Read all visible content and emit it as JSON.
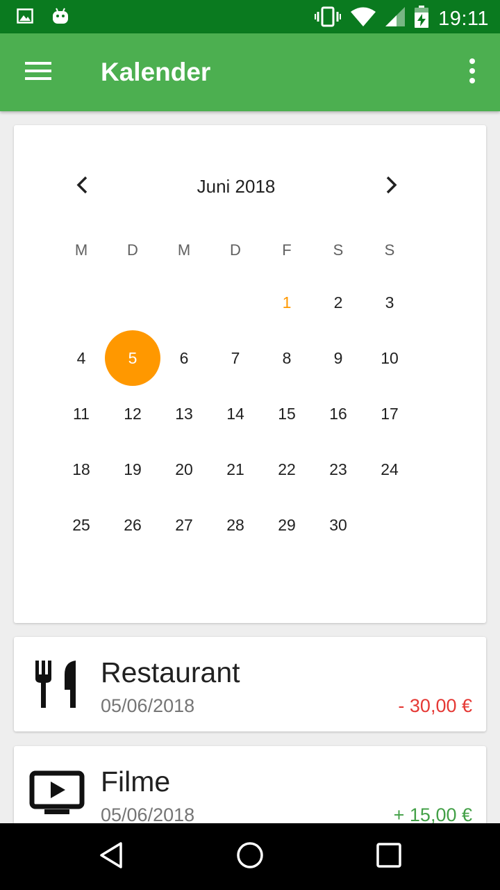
{
  "status_bar": {
    "time": "19:11",
    "icons": [
      "image-icon",
      "android-icon",
      "vibrate-icon",
      "wifi-icon",
      "signal-icon",
      "battery-charging-icon"
    ]
  },
  "app_bar": {
    "title": "Kalender",
    "icons": [
      "menu-icon",
      "more-vert-icon"
    ]
  },
  "calendar": {
    "month_label": "Juni 2018",
    "weekdays": [
      "M",
      "D",
      "M",
      "D",
      "F",
      "S",
      "S"
    ],
    "leading_empty_days": 4,
    "days": [
      "1",
      "2",
      "3",
      "4",
      "5",
      "6",
      "7",
      "8",
      "9",
      "10",
      "11",
      "12",
      "13",
      "14",
      "15",
      "16",
      "17",
      "18",
      "19",
      "20",
      "21",
      "22",
      "23",
      "24",
      "25",
      "26",
      "27",
      "28",
      "29",
      "30"
    ],
    "highlighted_day": "1",
    "selected_day": "5",
    "accent_color": "#ff9800"
  },
  "transactions": [
    {
      "title": "Restaurant",
      "date": "05/06/2018",
      "amount": "- 30,00 €",
      "amount_color": "#e53935",
      "icon": "restaurant-icon"
    },
    {
      "title": "Filme",
      "date": "05/06/2018",
      "amount": "+ 15,00 €",
      "amount_color": "#43a047",
      "icon": "tv-play-icon"
    }
  ],
  "nav_bar": {
    "icons": [
      "back-icon",
      "home-icon",
      "recents-icon"
    ]
  },
  "colors": {
    "status_bar": "#0a7a1f",
    "app_bar": "#4caf50",
    "accent": "#ff9800"
  }
}
